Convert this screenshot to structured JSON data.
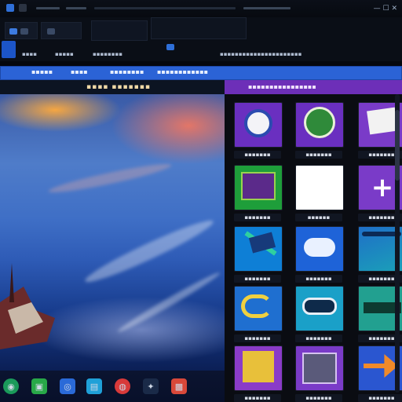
{
  "title_bar": {
    "window_controls": "— ☐ ✕"
  },
  "tabs": {
    "labels": [
      "▪▪▪▪",
      "▪▪▪▪▪",
      "▪▪▪▪▪▪▪▪",
      "▪▪▪▪▪▪▪▪▪▪▪▪▪▪▪▪▪▪▪▪▪▪"
    ]
  },
  "header": {
    "crumbs": [
      "▪▪▪▪▪",
      "▪▪▪▪",
      "▪▪▪▪▪▪▪▪",
      "▪▪▪▪▪▪▪▪▪▪▪▪"
    ]
  },
  "preview": {
    "title": "▪▪▪▪ ▪▪▪▪▪▪▪"
  },
  "gallery": {
    "header": "▪▪▪▪▪▪▪▪▪▪▪▪▪▪▪▪",
    "items": [
      {
        "caption": "▪▪▪▪▪▪▪",
        "icon": "disc-icon"
      },
      {
        "caption": "▪▪▪▪▪▪▪",
        "icon": "badge-icon"
      },
      {
        "caption": "▪▪▪▪▪▪▪",
        "icon": "document-icon"
      },
      {
        "caption": "▪▪▪▪▪▪▪",
        "icon": "map-icon"
      },
      {
        "caption": "▪▪▪▪▪▪",
        "icon": "blank-page-icon"
      },
      {
        "caption": "▪▪▪▪▪▪▪",
        "icon": "plus-icon"
      },
      {
        "caption": "▪▪▪▪▪▪▪",
        "icon": "abstract-icon"
      },
      {
        "caption": "▪▪▪▪▪▪▪",
        "icon": "cloud-icon"
      },
      {
        "caption": "▪▪▪▪▪▪▪",
        "icon": "landscape-icon"
      },
      {
        "caption": "▪▪▪▪▪▪▪",
        "icon": "ring-icon"
      },
      {
        "caption": "▪▪▪▪▪▪▪",
        "icon": "ship-icon"
      },
      {
        "caption": "▪▪▪▪▪▪▪",
        "icon": "banner-icon"
      },
      {
        "caption": "▪▪▪▪▪▪▪",
        "icon": "poster-icon"
      },
      {
        "caption": "▪▪▪▪▪▪▪",
        "icon": "photo-icon"
      },
      {
        "caption": "▪▪▪▪▪▪▪",
        "icon": "arrow-art-icon"
      }
    ]
  },
  "dock": {
    "apps": [
      {
        "icon": "globe-icon",
        "glyph": "◉"
      },
      {
        "icon": "folder-icon",
        "glyph": "▣"
      },
      {
        "icon": "media-icon",
        "glyph": "◎"
      },
      {
        "icon": "store-icon",
        "glyph": "▤"
      },
      {
        "icon": "chat-icon",
        "glyph": "◍"
      },
      {
        "icon": "paint-icon",
        "glyph": "✦"
      },
      {
        "icon": "terminal-icon",
        "glyph": "▩"
      }
    ]
  },
  "colors": {
    "accent_blue": "#2b63d6",
    "accent_purple": "#6d2fb8"
  }
}
